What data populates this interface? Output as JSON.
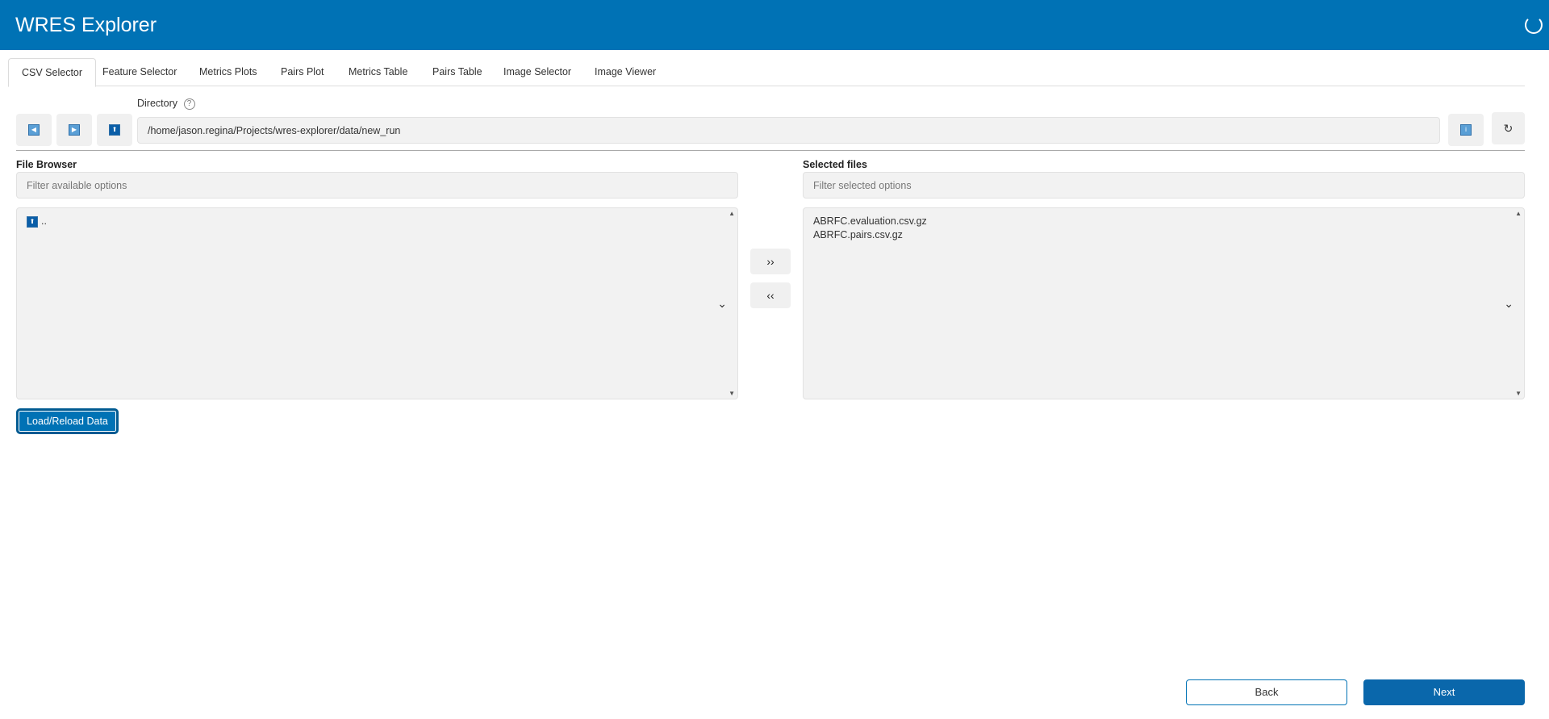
{
  "app": {
    "title": "WRES Explorer"
  },
  "tabs": [
    {
      "label": "CSV Selector",
      "active": true
    },
    {
      "label": "Feature Selector"
    },
    {
      "label": "Metrics Plots"
    },
    {
      "label": "Pairs Plot"
    },
    {
      "label": "Metrics Table"
    },
    {
      "label": "Pairs Table"
    },
    {
      "label": "Image Selector"
    },
    {
      "label": "Image Viewer"
    }
  ],
  "directory": {
    "label": "Directory",
    "help": "?",
    "value": "/home/jason.regina/Projects/wres-explorer/data/new_run"
  },
  "nav_buttons": {
    "back_icon": "◀",
    "forward_icon": "▶",
    "up_icon": "⬆",
    "info_icon": "i",
    "refresh_icon": "↻"
  },
  "file_browser": {
    "label": "File Browser",
    "filter_placeholder": "Filter available options",
    "items": [
      ".."
    ]
  },
  "selected_files": {
    "label": "Selected files",
    "filter_placeholder": "Filter selected options",
    "items": [
      "ABRFC.evaluation.csv.gz",
      "ABRFC.pairs.csv.gz"
    ]
  },
  "transfer": {
    "add_label": "››",
    "remove_label": "‹‹"
  },
  "load_button": {
    "label": "Load/Reload Data"
  },
  "footer": {
    "back_label": "Back",
    "next_label": "Next"
  },
  "colors": {
    "primary": "#0072b5",
    "panel_bg": "#f2f2f2"
  }
}
